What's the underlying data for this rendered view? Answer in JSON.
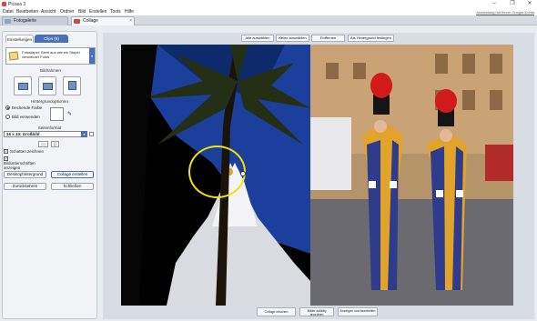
{
  "window": {
    "title": "Picasa 3",
    "minimize": "–",
    "maximize": "❐",
    "close": "✕"
  },
  "menu": {
    "items": [
      "Datei",
      "Bearbeiten",
      "Ansicht",
      "Ordner",
      "Bild",
      "Erstellen",
      "Tools",
      "Hilfe"
    ],
    "signin": "Anmeldung mit Ihrem Google-Konto"
  },
  "tabs": {
    "gallery": "Fotogalerie",
    "collage": "Collage",
    "close": "×"
  },
  "panel": {
    "tab_settings": "Einstellungen",
    "tab_clips": "Clips (6)",
    "style_text": "Fotostapel: Sieht aus wie ein Stapel verstreuter Fotos",
    "style_arrow": "▾",
    "frame_heading": "Bildrahmen",
    "bg_heading": "Hintergrundoptionen",
    "bg_option_color": "Deckende Farbe",
    "bg_option_image": "Bild verwenden",
    "eyedropper": "✎",
    "page_heading": "Seitenformat",
    "page_format": "16 x 10: Großbild",
    "page_format_arrow": "▾",
    "orient_landscape": "▭",
    "orient_portrait": "▯",
    "check_shadows": "Schatten zeichnen",
    "check_captions": "Bildunterschriften anzeigen",
    "check_mark": "✓",
    "btn_desktop": "Desktophintergrund",
    "btn_create": "Collage erstellen",
    "btn_back": "Zurückkehren",
    "btn_close": "Schließen"
  },
  "toolbar": {
    "select_all": "Alle auswählen",
    "select_none": "Keine auswählen",
    "remove": "Entfernen",
    "set_background": "Als Hintergrund festlegen"
  },
  "bottom": {
    "mix": "Collage mischen",
    "shuffle": "Bilder zufällig anordnen",
    "view_edit": "Anzeigen und bearbeiten"
  },
  "colors": {
    "accent": "#4a6fb5",
    "selection": "#f2e400",
    "sky": "#1b3f9a"
  },
  "icons": {
    "frame_1": "framed-photo-icon",
    "frame_2": "polaroid-photo-icon",
    "frame_3": "plain-photo-icon"
  }
}
